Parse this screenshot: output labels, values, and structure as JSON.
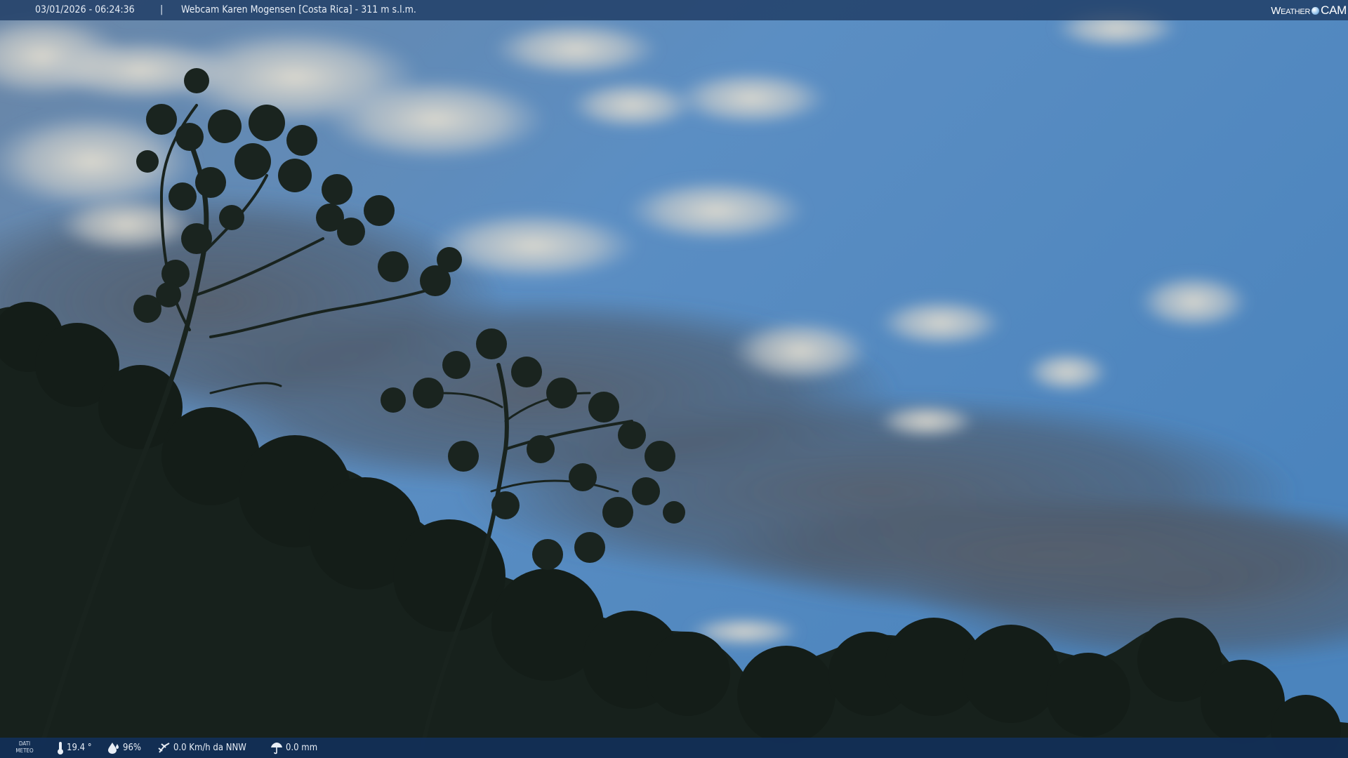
{
  "header": {
    "datetime": "03/01/2026 - 06:24:36",
    "separator": "|",
    "title": "Webcam Karen Mogensen [Costa Rica]  - 311 m s.l.m."
  },
  "logo": {
    "weather": "Weather",
    "cam": "CAM"
  },
  "meteo": {
    "label_line1": "DATI",
    "label_line2": "METEO",
    "temperature": "19.4 °",
    "humidity": "96%",
    "wind": "0.0 Km/h da NNW",
    "rain": "0.0 mm"
  },
  "icons": {
    "temperature": "thermometer-icon",
    "humidity": "humidity-drop-icon",
    "wind": "wind-icon",
    "rain": "rain-icon"
  },
  "colors": {
    "sky_top": "#4f78a8",
    "sky_mid": "#5c8dc2",
    "cloud": "#d8d6cc",
    "cloud_dark": "#3a4450",
    "forest": "#1a2520",
    "bar": "#1e3c64"
  }
}
